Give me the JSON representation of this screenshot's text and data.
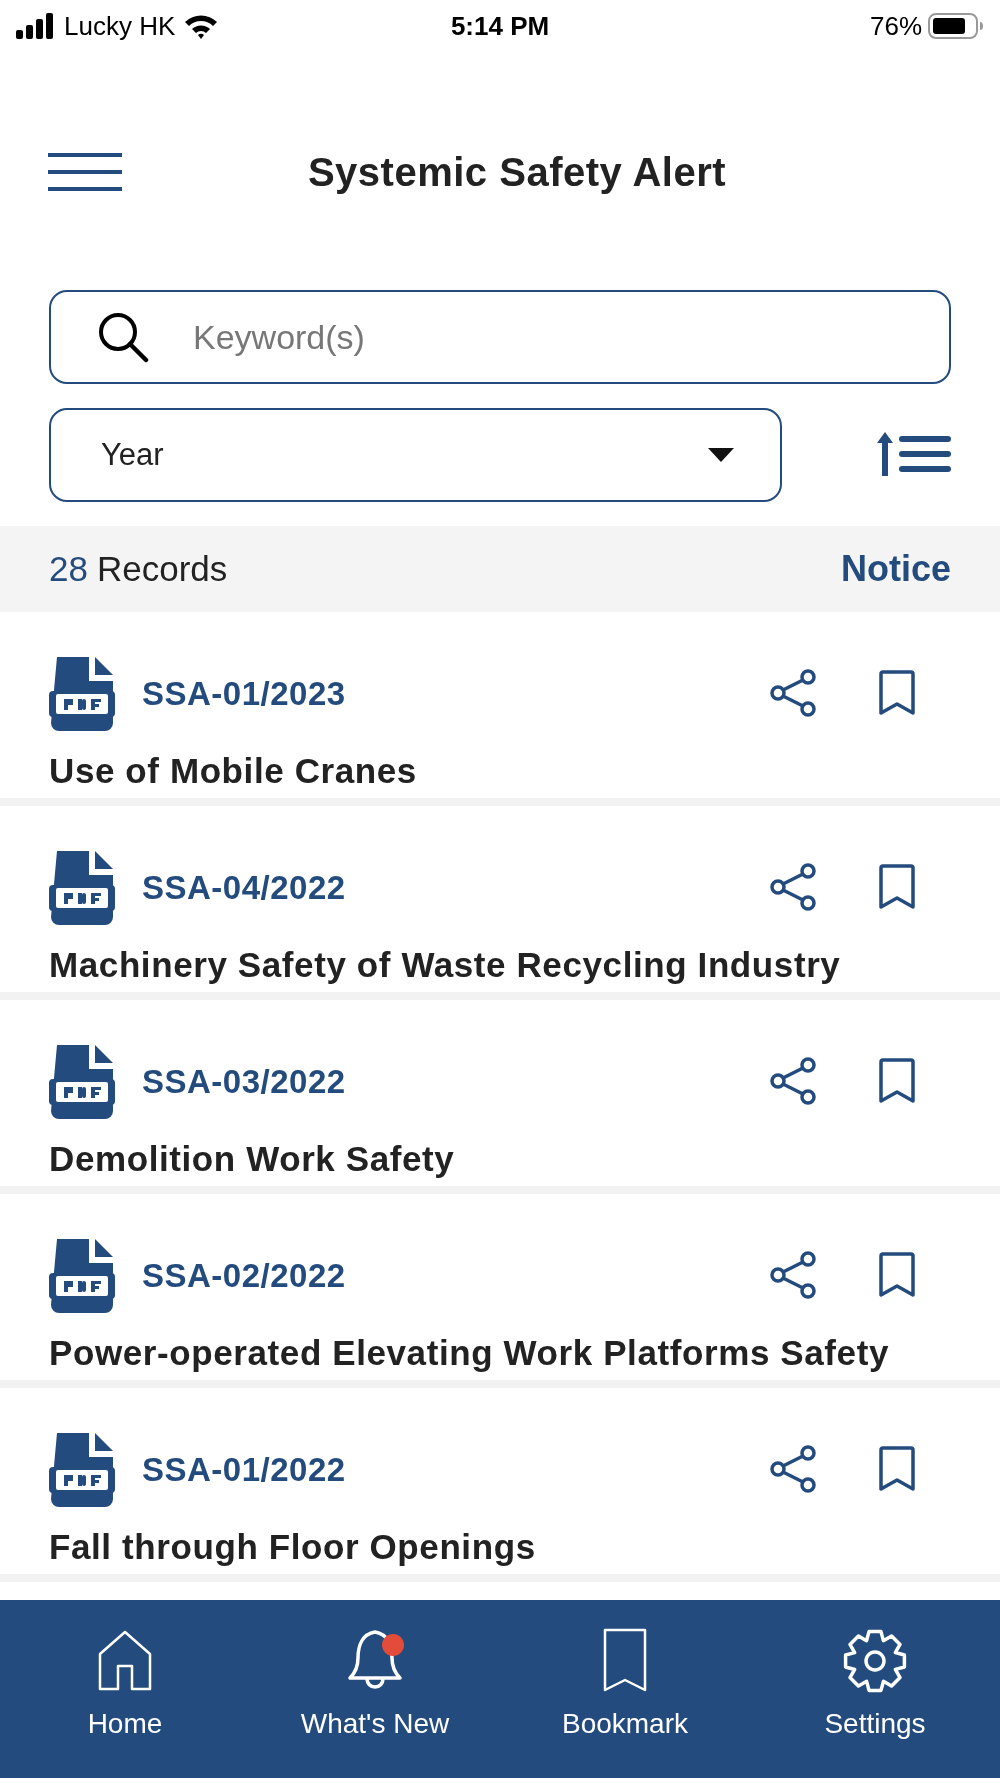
{
  "status_bar": {
    "carrier": "Lucky HK",
    "time": "5:14 PM",
    "battery": "76%"
  },
  "header": {
    "title": "Systemic Safety Alert"
  },
  "search": {
    "placeholder": "Keyword(s)"
  },
  "year_filter": {
    "value": "Year"
  },
  "summary": {
    "count": "28",
    "label": "Records",
    "notice": "Notice"
  },
  "records": [
    {
      "id": "SSA-01/2023",
      "title": "Use of Mobile Cranes",
      "bookmarked": false
    },
    {
      "id": "SSA-04/2022",
      "title": "Machinery Safety of Waste Recycling Industry",
      "bookmarked": false
    },
    {
      "id": "SSA-03/2022",
      "title": "Demolition Work Safety",
      "bookmarked": false
    },
    {
      "id": "SSA-02/2022",
      "title": "Power-operated Elevating Work Platforms Safety",
      "bookmarked": false
    },
    {
      "id": "SSA-01/2022",
      "title": "Fall through Floor Openings",
      "bookmarked": false
    }
  ],
  "tab_bar": [
    {
      "kind": "home",
      "label": "Home",
      "selected": false,
      "badge": false
    },
    {
      "kind": "bell",
      "label": "What's New",
      "selected": false,
      "badge": true
    },
    {
      "kind": "bookmark",
      "label": "Bookmark",
      "selected": false,
      "badge": false
    },
    {
      "kind": "gear",
      "label": "Settings",
      "selected": false,
      "badge": false
    }
  ]
}
